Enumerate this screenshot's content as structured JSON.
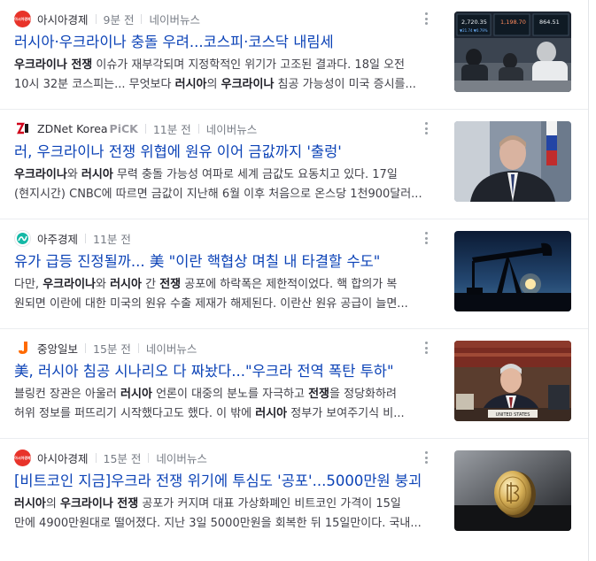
{
  "results": [
    {
      "press": "아시아경제",
      "logo_text": "아시아경제",
      "time": "9분 전",
      "sub": "네이버뉴스",
      "title": "러시아·우크라이나 충돌 우려...코스피·코스닥 내림세",
      "desc_line1": [
        {
          "t": "우크라이나 전쟁",
          "b": true
        },
        {
          "t": " 이슈가 재부각되며 지정학적인 위기가 고조된 결과다. 18일 오전",
          "b": false
        }
      ],
      "desc_line2": [
        {
          "t": "10시 32분 코스피는... 무엇보다 ",
          "b": false
        },
        {
          "t": "러시아",
          "b": true
        },
        {
          "t": "의 ",
          "b": false
        },
        {
          "t": "우크라이나",
          "b": true
        },
        {
          "t": " 침공 가능성이 미국 증시를...",
          "b": false
        }
      ],
      "thumb_texts": [
        "2,720.35",
        "1,198.70",
        "864.51",
        "▼21.74 ▼0.79%"
      ]
    },
    {
      "press": "ZDNet Korea",
      "pick": "PiCK",
      "time": "11분 전",
      "sub": "네이버뉴스",
      "title": "러, 우크라이나 전쟁 위협에 원유 이어 금값까지 '출렁'",
      "desc_line1": [
        {
          "t": "우크라이나",
          "b": true
        },
        {
          "t": "와 ",
          "b": false
        },
        {
          "t": "러시아",
          "b": true
        },
        {
          "t": " 무력 충돌 가능성 여파로 세계 금값도 요동치고 있다. 17일",
          "b": false
        }
      ],
      "desc_line2": [
        {
          "t": "(현지시간) CNBC에 따르면 금값이 지난해 6월 이후 처음으로 온스당 1천900달러...",
          "b": false
        }
      ]
    },
    {
      "press": "아주경제",
      "time": "11분 전",
      "title": "유가 급등 진정될까... 美 \"이란 핵협상 며칠 내 타결할 수도\"",
      "desc_line1": [
        {
          "t": "다만, ",
          "b": false
        },
        {
          "t": "우크라이나",
          "b": true
        },
        {
          "t": "와 ",
          "b": false
        },
        {
          "t": "러시아",
          "b": true
        },
        {
          "t": " 간 ",
          "b": false
        },
        {
          "t": "전쟁",
          "b": true
        },
        {
          "t": " 공포에 하락폭은 제한적이었다. 핵 합의가 복",
          "b": false
        }
      ],
      "desc_line2": [
        {
          "t": "원되면 이란에 대한 미국의 원유 수출 제재가 해제된다. 이란산 원유 공급이 늘면...",
          "b": false
        }
      ]
    },
    {
      "press": "중앙일보",
      "time": "15분 전",
      "sub": "네이버뉴스",
      "title": "美, 러시아 침공 시나리오 다 짜놨다...\"우크라 전역 폭탄 투하\"",
      "desc_line1": [
        {
          "t": "블링컨 장관은 아울러 ",
          "b": false
        },
        {
          "t": "러시아",
          "b": true
        },
        {
          "t": " 언론이 대중의 분노를 자극하고 ",
          "b": false
        },
        {
          "t": "전쟁",
          "b": true
        },
        {
          "t": "을 정당화하려",
          "b": false
        }
      ],
      "desc_line2": [
        {
          "t": "허위 정보를 퍼뜨리기 시작했다고도 했다. 이 밖에 ",
          "b": false
        },
        {
          "t": "러시아",
          "b": true
        },
        {
          "t": " 정부가 보여주기식 비...",
          "b": false
        }
      ],
      "thumb_texts": [
        "UNITED STATES"
      ]
    },
    {
      "press": "아시아경제",
      "logo_text": "아시아경제",
      "time": "15분 전",
      "sub": "네이버뉴스",
      "title": "[비트코인 지금]우크라 전쟁 위기에 투심도 '공포'...5000만원 붕괴",
      "desc_line1": [
        {
          "t": "러시아",
          "b": true
        },
        {
          "t": "의 ",
          "b": false
        },
        {
          "t": "우크라이나 전쟁",
          "b": true
        },
        {
          "t": " 공포가 커지며 대표 가상화폐인 비트코인 가격이 15일",
          "b": false
        }
      ],
      "desc_line2": [
        {
          "t": "만에 4900만원대로 떨어졌다. 지난 3일 5000만원을 회복한 뒤 15일만이다. 국내...",
          "b": false
        }
      ]
    }
  ],
  "colors": {
    "title": "#0c43b7",
    "meta": "#777c85",
    "asia_logo": "#e8332a",
    "zdnet_logo": "#d0021b",
    "aju_logo": "#14b8a6",
    "joongang_logo": "#ff6a00"
  },
  "icons": [
    "more-vertical-icon"
  ]
}
